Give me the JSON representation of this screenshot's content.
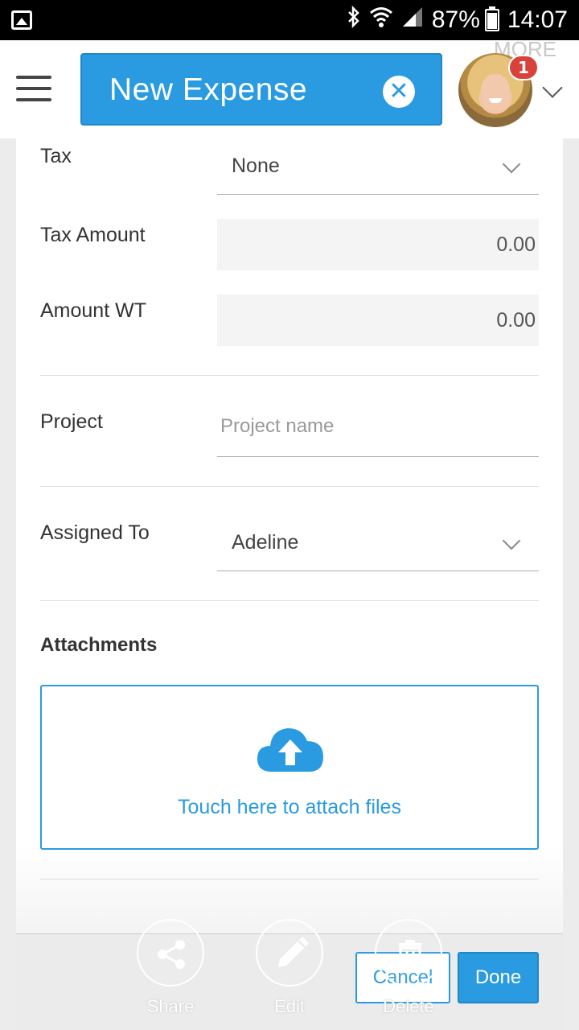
{
  "status_bar": {
    "battery": "87%",
    "time": "14:07",
    "icons": [
      "gallery-icon",
      "bluetooth-icon",
      "wifi-icon",
      "signal-icon",
      "battery-icon"
    ]
  },
  "header": {
    "title": "New Expense",
    "more_label": "MORE",
    "notification_count": "1",
    "accent": "#2a9be0"
  },
  "form": {
    "tax": {
      "label": "Tax",
      "value": "None"
    },
    "tax_amount": {
      "label": "Tax Amount",
      "value": "0.00"
    },
    "amount_wt": {
      "label": "Amount WT",
      "value": "0.00"
    },
    "project": {
      "label": "Project",
      "placeholder": "Project name",
      "value": ""
    },
    "assigned_to": {
      "label": "Assigned To",
      "value": "Adeline"
    }
  },
  "attachments": {
    "title": "Attachments",
    "prompt": "Touch here to attach files"
  },
  "actions": {
    "share": "Share",
    "edit": "Edit",
    "delete": "Delete",
    "cancel": "Cancel",
    "done": "Done"
  }
}
